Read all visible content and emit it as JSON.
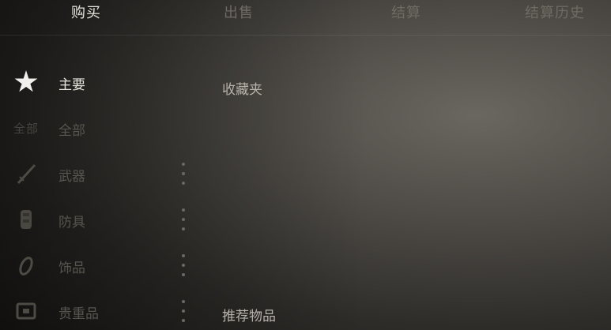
{
  "tabs": [
    {
      "label": "购买"
    },
    {
      "label": "出售"
    },
    {
      "label": "结算"
    },
    {
      "label": "结算历史"
    }
  ],
  "sidebar": {
    "items": [
      {
        "label": "主要",
        "icon": "star-icon"
      },
      {
        "label": "全部",
        "icon_text": "全部"
      },
      {
        "label": "武器",
        "icon": "sword-icon"
      },
      {
        "label": "防具",
        "icon": "armor-icon"
      },
      {
        "label": "饰品",
        "icon": "accessory-icon"
      },
      {
        "label": "贵重品",
        "icon": "chest-icon"
      }
    ]
  },
  "main": {
    "favorites_title": "收藏夹",
    "recommended_title": "推荐物品"
  },
  "colors": {
    "active_text": "#ebe7e0",
    "inactive_text": "#58554f"
  }
}
